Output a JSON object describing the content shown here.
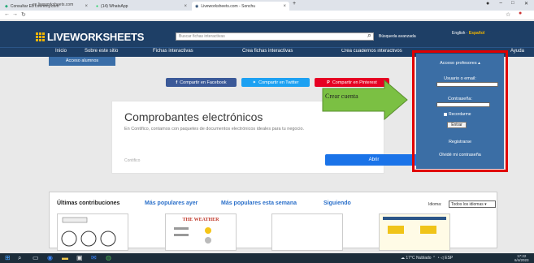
{
  "browser": {
    "tabs": [
      {
        "label": "Consultar Eb Lvemmy.com",
        "active": false
      },
      {
        "label": "(14) WhatsApp",
        "active": false
      },
      {
        "label": "Liveworksheets.com - Sonchu",
        "active": true
      }
    ],
    "new_tab": "+",
    "url": "es.liveworksheets.com",
    "window_controls": [
      "−",
      "□",
      "✕"
    ]
  },
  "site": {
    "logo": "LIVEWORKSHEETS",
    "search_placeholder": "Buscar fichas interactivas",
    "advanced_search": "Búsqueda avanzada",
    "lang_en": "English",
    "lang_es": "Español",
    "menu": [
      "Inicio",
      "Sobre este sitio",
      "Fichas interactivas",
      "Crea fichas interactivas",
      "Crea cuadernos interactivos",
      "Ayuda"
    ],
    "students_access": "Acceso alumnos"
  },
  "share": {
    "facebook": "Compartir en Facebook",
    "twitter": "Compartir en Twitter",
    "pinterest": "Compartir en Pinterest"
  },
  "ad": {
    "title": "Comprobantes electrónicos",
    "text": "En Contifico, contamos con paquetes de documentos electrónicos ideales para tu negocio.",
    "footer": "Contifico",
    "button": "Abrir"
  },
  "annotation": {
    "label": "Crear cuenta"
  },
  "login": {
    "title": "Acceso profesores",
    "user_label": "Usuario o email:",
    "password_label": "Contraseña:",
    "remember": "Recordarme",
    "submit": "Entrar",
    "register": "Registrarse",
    "forgot": "Olvidé mi contraseña"
  },
  "contributions": {
    "tabs": [
      "Últimas contribuciones",
      "Más populares ayer",
      "Más populares esta semana",
      "Siguiendo"
    ],
    "language_label": "Idioma:",
    "language_value": "Todos los idiomas",
    "cards": [
      "",
      "THE WEATHER",
      "",
      ""
    ]
  },
  "taskbar": {
    "weather": "17°C Nublado",
    "language": "ESP",
    "time": "17:22",
    "date": "6/4/2023"
  },
  "colors": {
    "header": "#1e3f66",
    "panel": "#3b6ea5",
    "highlight": "#e10000",
    "arrow": "#7bc043"
  }
}
